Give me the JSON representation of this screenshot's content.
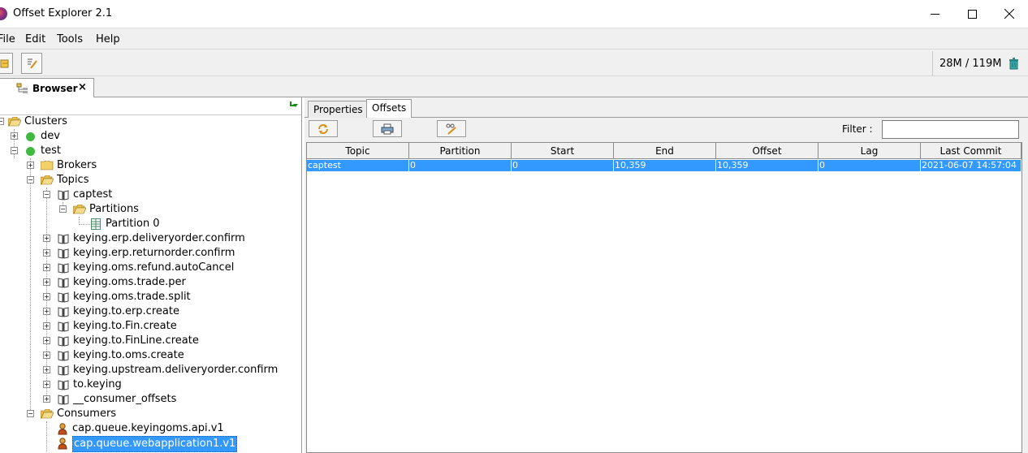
{
  "window": {
    "title": "Offset Explorer  2.1"
  },
  "menu": [
    {
      "label": "File"
    },
    {
      "label": "Edit"
    },
    {
      "label": "Tools"
    },
    {
      "label": "Help"
    }
  ],
  "toolbar": {
    "memory": "28M / 119M"
  },
  "browser_tab": {
    "label": "Browser",
    "close": "×"
  },
  "tree": {
    "clusters": "Clusters",
    "dev": "dev",
    "test": "test",
    "brokers": "Brokers",
    "topics": "Topics",
    "captest": "captest",
    "partitions": "Partitions",
    "partition0": "Partition 0",
    "topic_list": [
      "keying.erp.deliveryorder.confirm",
      "keying.erp.returnorder.confirm",
      "keying.oms.refund.autoCancel",
      "keying.oms.trade.per",
      "keying.oms.trade.split",
      "keying.to.erp.create",
      "keying.to.Fin.create",
      "keying.to.FinLine.create",
      "keying.to.oms.create",
      "keying.upstream.deliveryorder.confirm",
      "to.keying",
      "__consumer_offsets"
    ],
    "consumers": "Consumers",
    "consumer_list": [
      "cap.queue.keyingoms.api.v1",
      "cap.queue.webapplication1.v1"
    ]
  },
  "right": {
    "tabs": [
      "Properties",
      "Offsets"
    ],
    "filter_label": "Filter :",
    "filter_value": "",
    "columns": [
      "Topic",
      "Partition",
      "Start",
      "End",
      "Offset",
      "Lag",
      "Last Commit"
    ],
    "rows": [
      [
        "captest",
        "0",
        "0",
        "10,359",
        "10,359",
        "0",
        "2021-06-07 14:57:04"
      ]
    ]
  },
  "colors": {
    "selection": "#3399ff",
    "online": "#3fb93f"
  }
}
